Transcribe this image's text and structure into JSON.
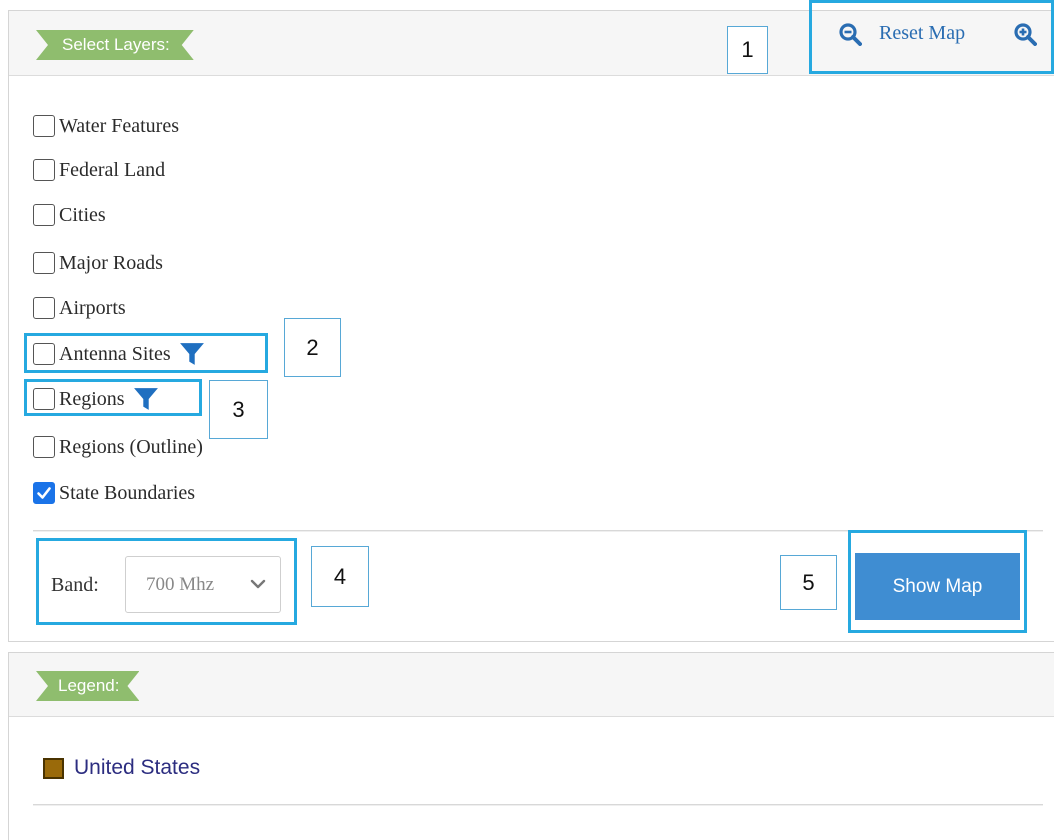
{
  "layers_panel": {
    "title": "Select Layers:",
    "reset_map_label": "Reset Map",
    "layers": [
      {
        "label": "Water Features",
        "checked": false
      },
      {
        "label": "Federal Land",
        "checked": false
      },
      {
        "label": "Cities",
        "checked": false
      },
      {
        "label": "Major Roads",
        "checked": false
      },
      {
        "label": "Airports",
        "checked": false
      },
      {
        "label": "Antenna Sites",
        "checked": false,
        "has_filter": true
      },
      {
        "label": "Regions",
        "checked": false,
        "has_filter": true
      },
      {
        "label": "Regions (Outline)",
        "checked": false
      },
      {
        "label": "State Boundaries",
        "checked": true
      }
    ],
    "band_label": "Band:",
    "band_value": "700 Mhz",
    "show_map_label": "Show Map"
  },
  "legend_panel": {
    "title": "Legend:",
    "items": [
      {
        "label": "United States",
        "color": "#9a6a0a"
      }
    ]
  },
  "callouts": [
    "1",
    "2",
    "3",
    "4",
    "5"
  ],
  "colors": {
    "ribbon": "#8fbd6e",
    "highlight": "#26a9e0",
    "button": "#3f8dd2",
    "link": "#2a6db2",
    "checkbox_checked": "#1a73e8"
  },
  "icons": {
    "zoom_out": "zoom-out-icon",
    "zoom_in": "zoom-in-icon",
    "filter": "filter-icon",
    "chevron": "chevron-down-icon",
    "checkmark": "checkmark-icon"
  }
}
